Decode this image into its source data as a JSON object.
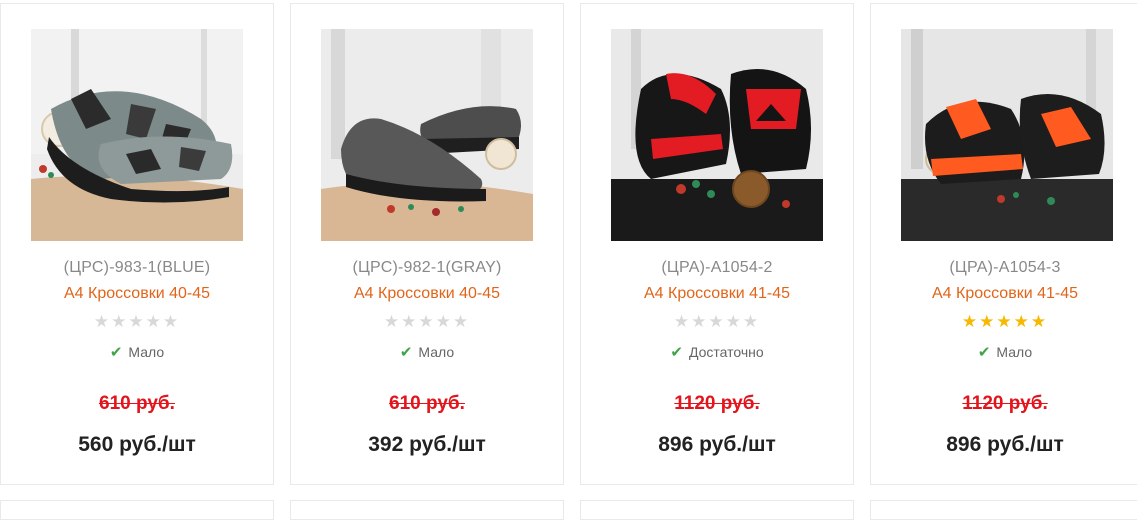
{
  "products": [
    {
      "sku": "(ЦРС)-983-1(BLUE)",
      "title": "А4 Кроссовки 40-45",
      "rating": 0,
      "stock": "Мало",
      "old_price": "610 руб.",
      "price": "560 руб./шт",
      "image": "camouflage-sneakers-photo"
    },
    {
      "sku": "(ЦРС)-982-1(GRAY)",
      "title": "А4 Кроссовки 40-45",
      "rating": 0,
      "stock": "Мало",
      "old_price": "610 руб.",
      "price": "392 руб./шт",
      "image": "gray-knit-sneakers-photo"
    },
    {
      "sku": "(ЦРА)-А1054-2",
      "title": "А4 Кроссовки 41-45",
      "rating": 0,
      "stock": "Достаточно",
      "old_price": "1120 руб.",
      "price": "896 руб./шт",
      "image": "black-red-sneakers-photo"
    },
    {
      "sku": "(ЦРА)-А1054-3",
      "title": "А4 Кроссовки 41-45",
      "rating": 5,
      "stock": "Мало",
      "old_price": "1120 руб.",
      "price": "896 руб./шт",
      "image": "black-orange-sneakers-photo"
    }
  ],
  "colors": {
    "accent": "#e0651a",
    "old_price": "#e3141b",
    "star_on": "#f6b800",
    "star_off": "#d8d8d8",
    "check": "#3fa34d"
  }
}
